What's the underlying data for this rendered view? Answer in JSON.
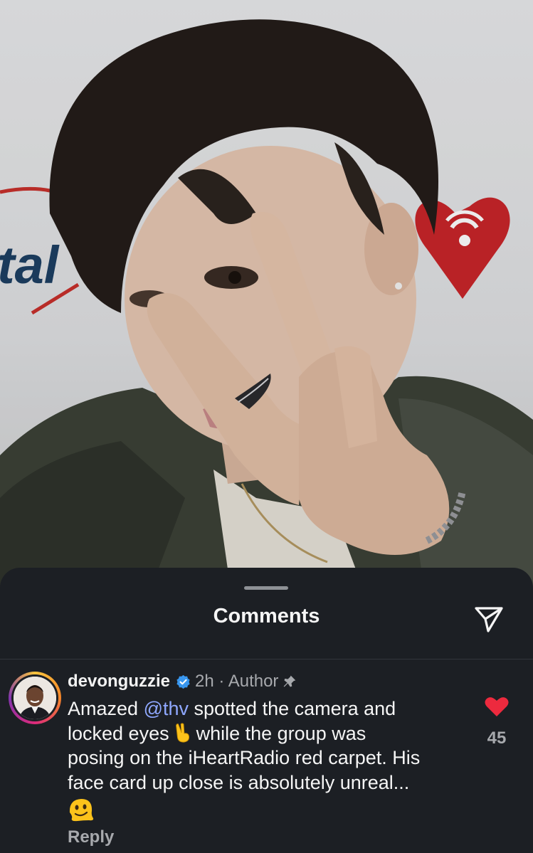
{
  "post": {
    "photo_icon": "portrait-photo",
    "backdrop_text": "tal"
  },
  "sheet": {
    "title": "Comments",
    "share_icon": "send-icon"
  },
  "comment": {
    "username": "devonguzzie",
    "verified_icon": "verified-badge-icon",
    "time_author": "2h · Author",
    "pin_icon": "pin-icon",
    "text_before_mention": "Amazed ",
    "mention": "@thv",
    "text_line1_after": " spotted the camera and",
    "text_line2_before_emoji": "locked eyes",
    "emoji_inline": "victory-hand-emoji",
    "text_line2_after": "while the group was",
    "text_line3": "posing on the iHeartRadio red carpet. His",
    "text_line4": "face card up close is absolutely unreal...",
    "emoji_end": "melting-face-emoji",
    "reply_label": "Reply",
    "like_count": "45",
    "like_color": "#ed2a3e"
  }
}
